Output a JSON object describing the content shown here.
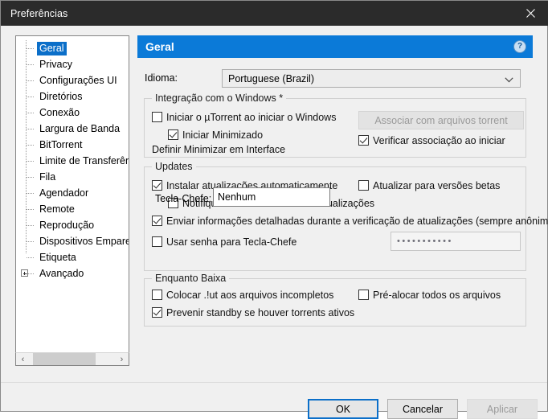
{
  "window": {
    "title": "Preferências",
    "close_icon": "close-icon"
  },
  "sidebar": {
    "items": [
      {
        "label": "Geral",
        "selected": true,
        "expandable": false
      },
      {
        "label": "Privacy",
        "selected": false,
        "expandable": false
      },
      {
        "label": "Configurações UI",
        "selected": false,
        "expandable": false
      },
      {
        "label": "Diretórios",
        "selected": false,
        "expandable": false
      },
      {
        "label": "Conexão",
        "selected": false,
        "expandable": false
      },
      {
        "label": "Largura de Banda",
        "selected": false,
        "expandable": false
      },
      {
        "label": "BitTorrent",
        "selected": false,
        "expandable": false
      },
      {
        "label": "Limite de Transferência",
        "selected": false,
        "expandable": false
      },
      {
        "label": "Fila",
        "selected": false,
        "expandable": false
      },
      {
        "label": "Agendador",
        "selected": false,
        "expandable": false
      },
      {
        "label": "Remote",
        "selected": false,
        "expandable": false
      },
      {
        "label": "Reprodução",
        "selected": false,
        "expandable": false
      },
      {
        "label": "Dispositivos Emparelhados",
        "selected": false,
        "expandable": false
      },
      {
        "label": "Etiqueta",
        "selected": false,
        "expandable": false
      },
      {
        "label": "Avançado",
        "selected": false,
        "expandable": true
      }
    ],
    "scrollbar": {
      "left_arrow": "‹",
      "right_arrow": "›"
    }
  },
  "main": {
    "page_title": "Geral",
    "help_icon_label": "?",
    "language": {
      "label": "Idioma:",
      "value": "Portuguese (Brazil)",
      "chevron": "chevron-down-icon"
    },
    "windows_group": {
      "title": "Integração com o Windows *",
      "start_with_windows": {
        "label": "Iniciar o µTorrent ao iniciar o Windows",
        "checked": false
      },
      "start_minimized": {
        "label": "Iniciar Minimizado",
        "checked": true
      },
      "minimize_note": "Definir Minimizar em Interface",
      "associate_button": "Associar com arquivos torrent",
      "check_association": {
        "label": "Verificar associação ao iniciar",
        "checked": true
      }
    },
    "updates_group": {
      "title": "Updates",
      "install_auto": {
        "label": "Instalar atualizações automaticamente",
        "checked": true
      },
      "update_beta": {
        "label": "Atualizar para versões betas",
        "checked": false
      },
      "notify_before": {
        "label": "Notifique-me antes de instalar atualizações",
        "checked": false
      },
      "send_detailed": {
        "label": "Enviar informações detalhadas durante a verificação de atualizações (sempre anônimo)",
        "checked": true
      },
      "use_password": {
        "label": "Usar senha para Tecla-Chefe",
        "checked": false
      },
      "password_value": "•••••••••••",
      "hotkey_label": "Tecla-Chefe:",
      "hotkey_value": "Nenhum"
    },
    "download_group": {
      "title": "Enquanto Baixa",
      "append_ut": {
        "label": "Colocar .!ut aos arquivos incompletos",
        "checked": false
      },
      "preallocate": {
        "label": "Pré-alocar todos os arquivos",
        "checked": false
      },
      "prevent_standby": {
        "label": "Prevenir standby se houver torrents ativos",
        "checked": true
      }
    }
  },
  "footer": {
    "ok": "OK",
    "cancel": "Cancelar",
    "apply": "Aplicar"
  },
  "colors": {
    "titlebar": "#2b2b2b",
    "header_blue": "#0b7ad8",
    "selection_blue": "#0b6fc9",
    "dialog_bg": "#f0f0f0"
  }
}
